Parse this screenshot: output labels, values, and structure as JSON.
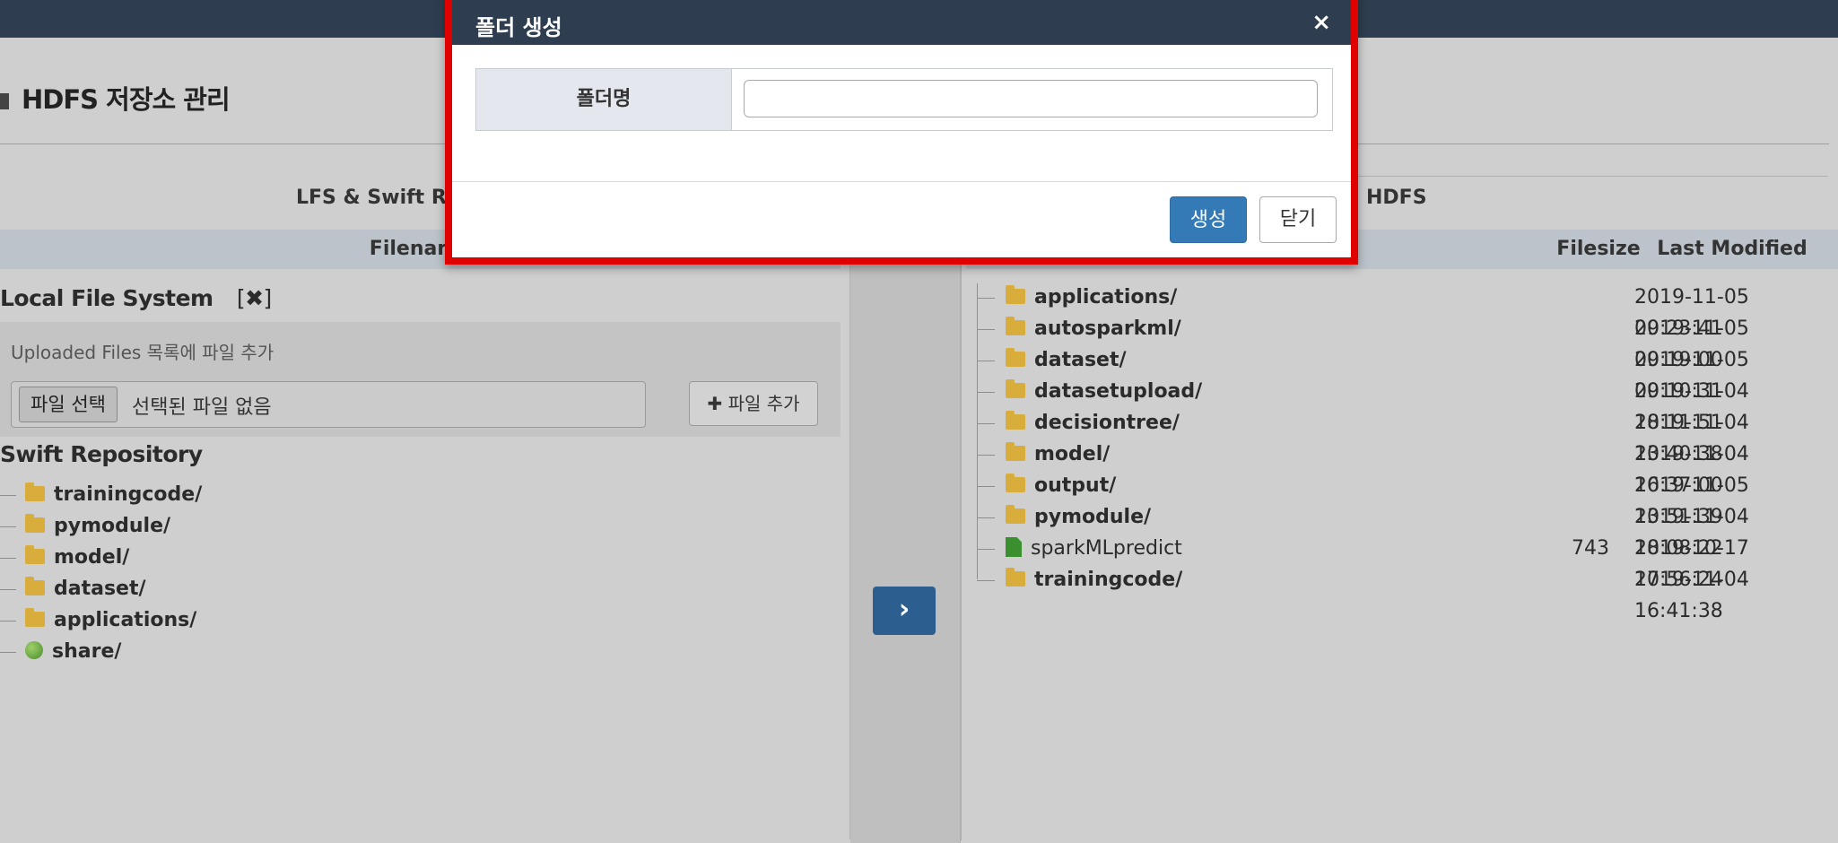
{
  "page": {
    "title": "HDFS 저장소 관리"
  },
  "left_panel": {
    "header": "LFS & Swift Re",
    "column_filename": "Filename",
    "lfs_title": "Local File System",
    "lfs_toggle": "[✖]",
    "upload_caption": "Uploaded Files 목록에 파일 추가",
    "file_button": "파일 선택",
    "file_status": "선택된 파일 없음",
    "add_file_button": "✚ 파일 추가",
    "swift_title": "Swift Repository",
    "swift_items": [
      {
        "name": "trainingcode/",
        "icon": "folder-icon"
      },
      {
        "name": "pymodule/",
        "icon": "folder-icon"
      },
      {
        "name": "model/",
        "icon": "folder-icon"
      },
      {
        "name": "dataset/",
        "icon": "folder-icon"
      },
      {
        "name": "applications/",
        "icon": "folder-icon"
      },
      {
        "name": "share/",
        "icon": "globe-icon"
      }
    ]
  },
  "transfer": {
    "label": "›"
  },
  "right_panel": {
    "header": "HDFS",
    "column_filesize": "Filesize",
    "column_modified": "Last Modified",
    "items": [
      {
        "name": "applications/",
        "icon": "folder-icon",
        "size": "",
        "modified": "2019-11-05 09:23:41"
      },
      {
        "name": "autosparkml/",
        "icon": "folder-icon",
        "size": "",
        "modified": "2019-11-05 09:19:00"
      },
      {
        "name": "dataset/",
        "icon": "folder-icon",
        "size": "",
        "modified": "2019-11-05 09:10:31"
      },
      {
        "name": "datasetupload/",
        "icon": "folder-icon",
        "size": "",
        "modified": "2019-11-04 18:11:51"
      },
      {
        "name": "decisiontree/",
        "icon": "folder-icon",
        "size": "",
        "modified": "2019-11-04 13:40:38"
      },
      {
        "name": "model/",
        "icon": "folder-icon",
        "size": "",
        "modified": "2019-11-04 16:37:00"
      },
      {
        "name": "output/",
        "icon": "folder-icon",
        "size": "",
        "modified": "2019-11-05 13:51:39"
      },
      {
        "name": "pymodule/",
        "icon": "folder-icon",
        "size": "",
        "modified": "2019-11-04 18:08:22"
      },
      {
        "name": "sparkMLpredict",
        "icon": "file-icon",
        "size": "743",
        "modified": "2019-10-17 17:56:24"
      },
      {
        "name": "trainingcode/",
        "icon": "folder-icon",
        "size": "",
        "modified": "2019-11-04 16:41:38"
      }
    ]
  },
  "modal": {
    "title": "폴더 생성",
    "close": "×",
    "label": "폴더명",
    "input_value": "",
    "create_button": "생성",
    "close_button": "닫기"
  },
  "colors": {
    "topbar": "#2e3e50",
    "primary": "#337ab7",
    "highlight_border": "#e00000"
  }
}
